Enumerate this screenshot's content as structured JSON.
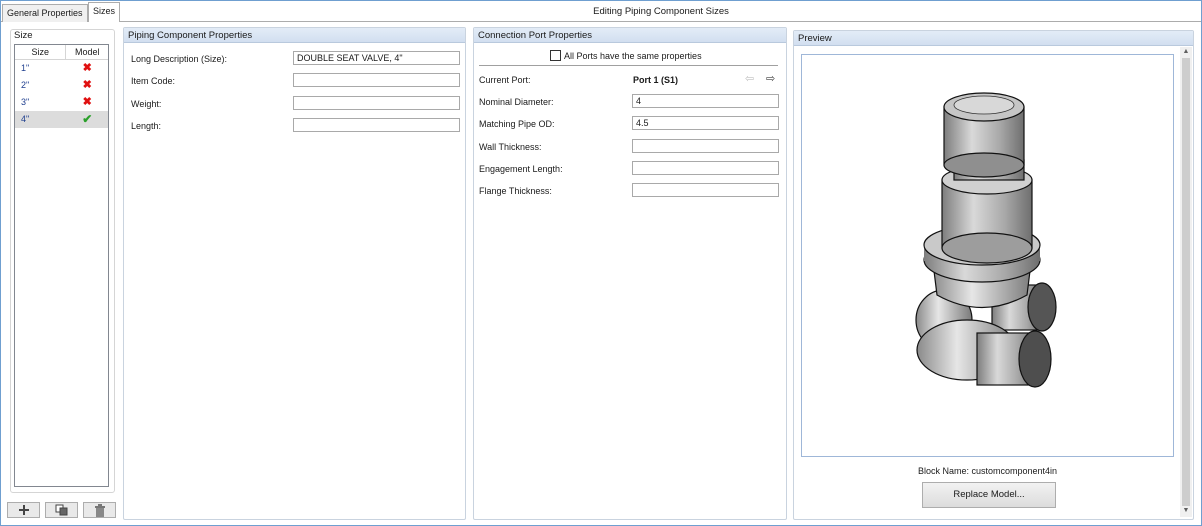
{
  "tabs": [
    {
      "label": "General Properties",
      "active": false
    },
    {
      "label": "Sizes",
      "active": true
    }
  ],
  "window_title": "Editing Piping Component Sizes",
  "size_panel": {
    "group_label": "Size",
    "columns": [
      "Size",
      "Model"
    ],
    "rows": [
      {
        "size": "1\"",
        "model": "✖",
        "status": "missing"
      },
      {
        "size": "2\"",
        "model": "✖",
        "status": "missing"
      },
      {
        "size": "3\"",
        "model": "✖",
        "status": "missing"
      },
      {
        "size": "4\"",
        "model": "✔",
        "status": "ok",
        "selected": true
      }
    ],
    "buttons": [
      {
        "icon": "add-icon",
        "glyph": "✚"
      },
      {
        "icon": "copy-icon",
        "glyph": "❐"
      },
      {
        "icon": "trash-icon",
        "glyph": "🗑"
      }
    ]
  },
  "piping": {
    "header": "Piping Component Properties",
    "fields": [
      {
        "label": "Long Description (Size):",
        "value": "DOUBLE SEAT VALVE, 4\""
      },
      {
        "label": "Item Code:",
        "value": ""
      },
      {
        "label": "Weight:",
        "value": ""
      },
      {
        "label": "Length:",
        "value": ""
      }
    ]
  },
  "connection": {
    "header": "Connection Port Properties",
    "same_props_label": "All Ports have the same properties",
    "same_props_checked": false,
    "current_port_label": "Current Port:",
    "current_port_value": "Port 1 (S1)",
    "prev_arrow": "⇦",
    "next_arrow": "⇨",
    "fields": [
      {
        "label": "Nominal Diameter:",
        "value": "4"
      },
      {
        "label": "Matching Pipe OD:",
        "value": "4.5"
      },
      {
        "label": "Wall Thickness:",
        "value": ""
      },
      {
        "label": "Engagement Length:",
        "value": ""
      },
      {
        "label": "Flange Thickness:",
        "value": ""
      }
    ]
  },
  "preview": {
    "header": "Preview",
    "block_name": "Block Name: customcomponent4in",
    "replace_button": "Replace Model..."
  },
  "colors": {
    "accent_border": "#6f9fd0",
    "header_bg": "#d2dff0",
    "error": "#e01010",
    "ok": "#2aa02a"
  }
}
